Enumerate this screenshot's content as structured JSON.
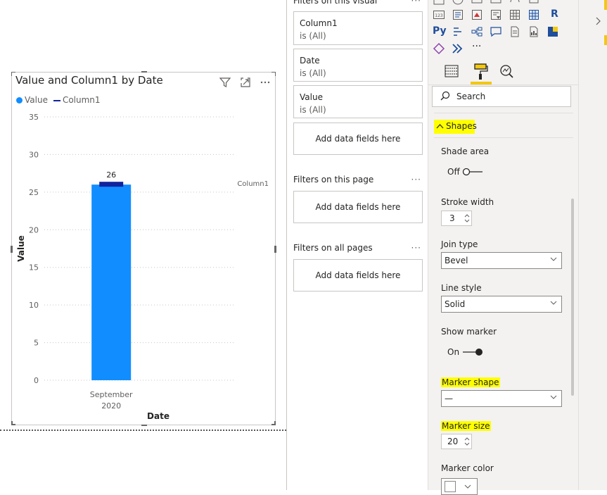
{
  "visual": {
    "title": "Value and Column1 by Date",
    "legend": {
      "value_label": "Value",
      "column1_label": "Column1"
    }
  },
  "chart_data": {
    "type": "bar",
    "categories": [
      "September 2020"
    ],
    "series": [
      {
        "name": "Value",
        "values": [
          26
        ],
        "color": "#118dff",
        "kind": "bar"
      },
      {
        "name": "Column1",
        "values": [
          26
        ],
        "color": "#12239e",
        "kind": "line-marker"
      }
    ],
    "data_labels": [
      "26"
    ],
    "title": "Value and Column1 by Date",
    "xlabel": "Date",
    "ylabel": "Value",
    "ylim": [
      0,
      35
    ],
    "yticks": [
      "0",
      "5",
      "10",
      "15",
      "20",
      "25",
      "30",
      "35"
    ],
    "xtick_lines": [
      "September",
      "2020"
    ],
    "annotation": "Column1",
    "grid": true,
    "legend_placement": "top-left"
  },
  "filters": {
    "visual_header": "Filters on this visual",
    "cards": [
      {
        "field": "Column1",
        "value": "is (All)"
      },
      {
        "field": "Date",
        "value": "is (All)"
      },
      {
        "field": "Value",
        "value": "is (All)"
      }
    ],
    "add_label": "Add data fields here",
    "page_header": "Filters on this page",
    "all_header": "Filters on all pages",
    "more": "···"
  },
  "viz": {
    "search_placeholder": "Search",
    "r_label": "R",
    "py_label": "Py",
    "more": "···",
    "shapes_header": "Shapes",
    "shade_area": {
      "label": "Shade area",
      "state": "Off"
    },
    "stroke_width": {
      "label": "Stroke width",
      "value": "3"
    },
    "join_type": {
      "label": "Join type",
      "value": "Bevel"
    },
    "line_style": {
      "label": "Line style",
      "value": "Solid"
    },
    "show_marker": {
      "label": "Show marker",
      "state": "On"
    },
    "marker_shape": {
      "label": "Marker shape",
      "value": "—"
    },
    "marker_size": {
      "label": "Marker size",
      "value": "20"
    },
    "marker_color": {
      "label": "Marker color"
    }
  },
  "colors": {
    "accent": "#118dff",
    "line": "#12239e",
    "highlight": "#ffff00",
    "brand": "#f2c811"
  }
}
